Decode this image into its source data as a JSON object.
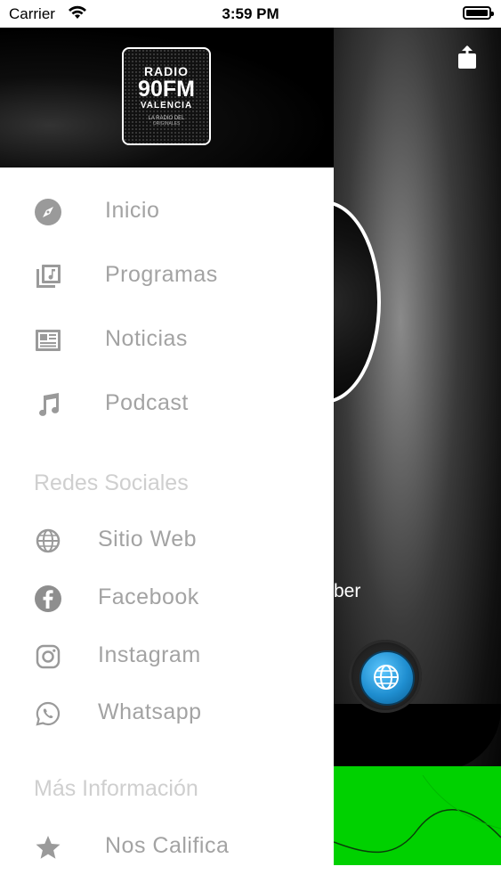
{
  "status_bar": {
    "carrier": "Carrier",
    "time": "3:59 PM"
  },
  "logo": {
    "line1": "RADIO",
    "line2": "90FM",
    "line3": "VALENCIA",
    "line4": "LA RADIO DEL",
    "line5": "ORIGINALES"
  },
  "menu": [
    {
      "label": "Inicio",
      "icon": "compass-icon"
    },
    {
      "label": "Programas",
      "icon": "music-library-icon"
    },
    {
      "label": "Noticias",
      "icon": "newspaper-icon"
    },
    {
      "label": "Podcast",
      "icon": "music-note-icon"
    }
  ],
  "social_title": "Redes Sociales",
  "social": [
    {
      "label": "Sitio  Web",
      "icon": "globe-icon"
    },
    {
      "label": "Facebook",
      "icon": "facebook-icon"
    },
    {
      "label": "Instagram",
      "icon": "instagram-icon"
    },
    {
      "label": "Whatsapp",
      "icon": "whatsapp-icon"
    }
  ],
  "info_title": "Más Información",
  "info": [
    {
      "label": "Nos  Califica",
      "icon": "star-icon"
    }
  ],
  "background": {
    "fragment_text": "ber"
  },
  "colors": {
    "accent_green": "#00d100",
    "menu_text": "#a3a3a3",
    "section_text": "#cfcfcf",
    "icon": "#9a9a9a"
  }
}
